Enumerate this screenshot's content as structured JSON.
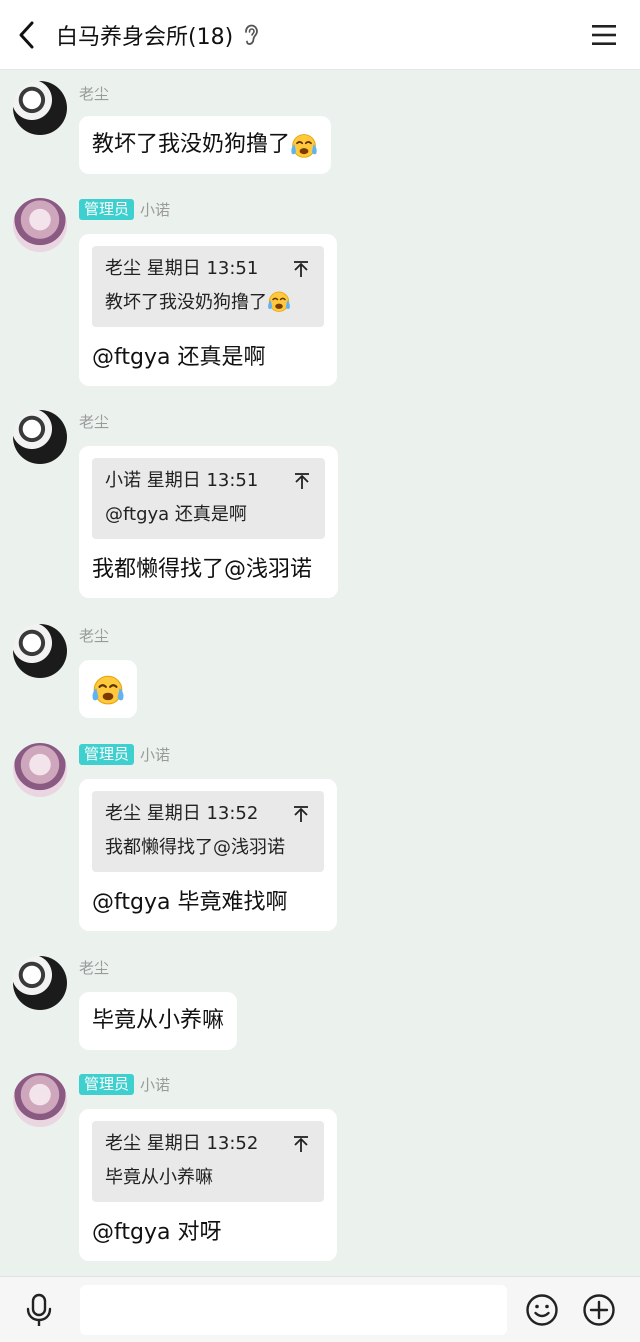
{
  "header": {
    "title": "白马养身会所(18)",
    "back_icon": "chevron-left-icon",
    "status_icon": "ear-icon",
    "menu_icon": "hamburger-menu-icon"
  },
  "messages": [
    {
      "sender": "老尘",
      "avatar": "manga-avatar",
      "text": "教坏了我没奶狗撸了",
      "emoji": "crying-face"
    },
    {
      "sender": "小诺",
      "role": "管理员",
      "avatar": "girl-avatar",
      "quote": {
        "head": "老尘 星期日 13:51",
        "body": "教坏了我没奶狗撸了",
        "body_emoji": "crying-face"
      },
      "text": "@ftgya 还真是啊"
    },
    {
      "sender": "老尘",
      "avatar": "manga-avatar",
      "quote": {
        "head": "小诺 星期日 13:51",
        "body": "@ftgya 还真是啊"
      },
      "text": "我都懒得找了@浅羽诺"
    },
    {
      "sender": "老尘",
      "avatar": "manga-avatar",
      "emoji": "crying-face"
    },
    {
      "sender": "小诺",
      "role": "管理员",
      "avatar": "girl-avatar",
      "quote": {
        "head": "老尘 星期日 13:52",
        "body": "我都懒得找了@浅羽诺"
      },
      "text": "@ftgya 毕竟难找啊"
    },
    {
      "sender": "老尘",
      "avatar": "manga-avatar",
      "text": "毕竟从小养嘛"
    },
    {
      "sender": "小诺",
      "role": "管理员",
      "avatar": "girl-avatar",
      "quote": {
        "head": "老尘 星期日 13:52",
        "body": "毕竟从小养嘛"
      },
      "text": "@ftgya 对呀"
    }
  ],
  "input_bar": {
    "placeholder": "",
    "mic_icon": "microphone-icon",
    "emoji_icon": "smiley-icon",
    "plus_icon": "plus-circle-icon"
  },
  "colors": {
    "background": "#ebf1ed",
    "admin_badge": "#3ecfcf",
    "bubble": "#ffffff",
    "quote": "#e9e9e9"
  }
}
